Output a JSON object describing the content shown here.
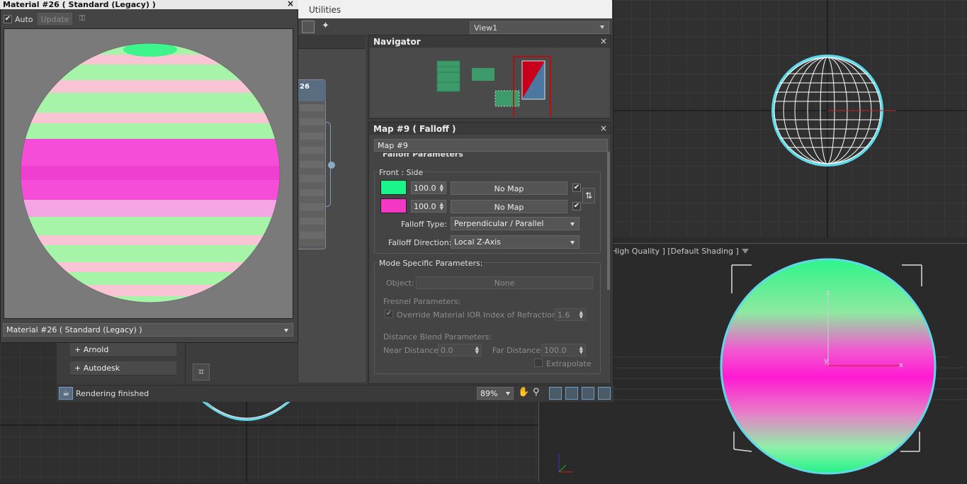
{
  "viewports": {
    "perspective_label": "High Quality ] [Default Shading ]"
  },
  "slate": {
    "menu_utilities": "Utilities",
    "view_select": "View1",
    "canvas_node_label": "26",
    "status_text": "Rendering finished",
    "zoom_value": "89%"
  },
  "material_window": {
    "title": "Material #26  ( Standard (Legacy) )",
    "auto_label": "Auto",
    "auto_checked": true,
    "update_label": "Update",
    "material_select": "Material #26  ( Standard (Legacy) )"
  },
  "browser": {
    "items": [
      "+ Arnold",
      "+ Autodesk"
    ]
  },
  "navigator": {
    "title": "Navigator"
  },
  "map_params": {
    "title": "Map #9  ( Falloff )",
    "map_name": "Map #9",
    "rollout_title": "Falloff Parameters",
    "front_side_label": "Front : Side",
    "color1": {
      "hex": "#19f58a",
      "amount": "100.0",
      "map_label": "No Map",
      "enabled": true
    },
    "color2": {
      "hex": "#f537c6",
      "amount": "100.0",
      "map_label": "No Map",
      "enabled": true
    },
    "falloff_type_label": "Falloff Type:",
    "falloff_type_value": "Perpendicular / Parallel",
    "falloff_direction_label": "Falloff Direction:",
    "falloff_direction_value": "Local Z-Axis",
    "mode_specific_title": "Mode Specific Parameters:",
    "object_label": "Object:",
    "object_value": "None",
    "fresnel_title": "Fresnel Parameters:",
    "override_ior_label": "Override Material IOR",
    "override_ior_checked": true,
    "ior_label": "Index of Refraction",
    "ior_value": "1.6",
    "distance_blend_title": "Distance Blend Parameters:",
    "near_distance_label": "Near Distance:",
    "near_distance_value": "0.0",
    "far_distance_label": "Far Distance:",
    "far_distance_value": "100.0",
    "extrapolate_label": "Extrapolate"
  }
}
